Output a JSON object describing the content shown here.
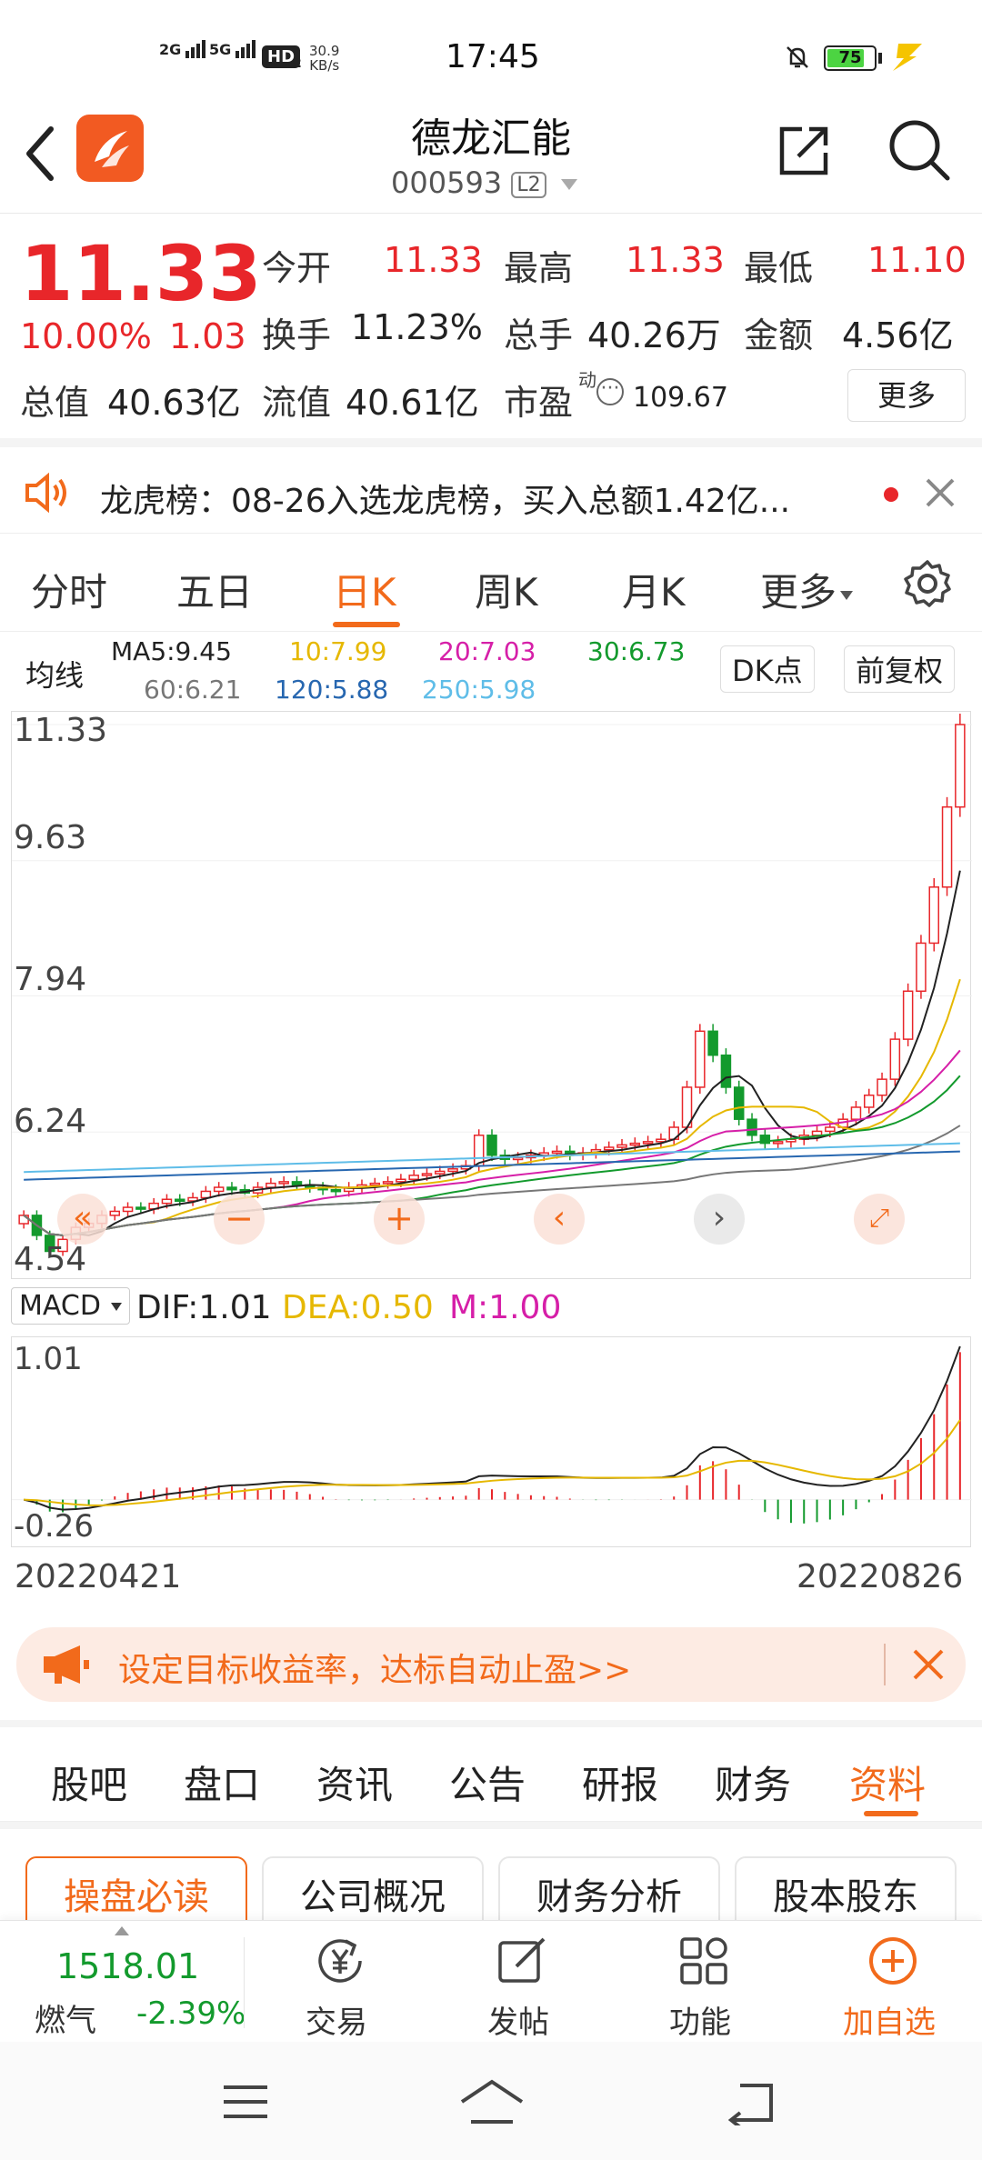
{
  "status": {
    "sig1": "2G",
    "sig2": "5G",
    "hd": "HD",
    "hd_sub": "2",
    "speed_value": "30.9",
    "speed_unit": "KB/s",
    "time": "17:45",
    "battery": "75"
  },
  "header": {
    "title": "德龙汇能",
    "code": "000593",
    "level": "L2"
  },
  "quote": {
    "price": "11.33",
    "change_pct": "10.00%",
    "change_abs": "1.03",
    "open_label": "今开",
    "open_value": "11.33",
    "high_label": "最高",
    "high_value": "11.33",
    "low_label": "最低",
    "low_value": "11.10",
    "turnover_label": "换手",
    "turnover_value": "11.23%",
    "volume_label": "总手",
    "volume_value": "40.26万",
    "amount_label": "金额",
    "amount_value": "4.56亿",
    "mktcap_label": "总值",
    "mktcap_value": "40.63亿",
    "float_label": "流值",
    "float_value": "40.61亿",
    "pe_label": "市盈",
    "pe_sup": "动",
    "pe_value": "109.67",
    "more_button": "更多"
  },
  "notice": {
    "text": "龙虎榜：08-26入选龙虎榜，买入总额1.42亿..."
  },
  "periods": {
    "tabs": [
      "分时",
      "五日",
      "日K",
      "周K",
      "月K",
      "更多"
    ],
    "active_index": 2
  },
  "ma": {
    "label": "均线",
    "ma5": "MA5:9.45",
    "ma10": "10:7.99",
    "ma20": "20:7.03",
    "ma30": "30:6.73",
    "ma60": "60:6.21",
    "ma120": "120:5.88",
    "ma250": "250:5.98",
    "dk_button": "DK点",
    "adjust_button": "前复权",
    "colors": {
      "ma5": "#222222",
      "ma10": "#e6b800",
      "ma20": "#d61fa8",
      "ma30": "#139a2d",
      "ma60": "#777777",
      "ma120": "#2767b0",
      "ma250": "#5fbde8"
    }
  },
  "macd": {
    "selector": "MACD",
    "dif": "DIF:1.01",
    "dea": "DEA:0.50",
    "m": "M:1.00",
    "axis_top": "1.01",
    "axis_bottom": "-0.26"
  },
  "dates": {
    "start": "20220421",
    "end": "20220826"
  },
  "chart_data": {
    "type": "candlestick",
    "y_ticks": [
      "11.33",
      "9.63",
      "7.94",
      "6.24",
      "4.54"
    ],
    "ylim": [
      4.54,
      11.33
    ],
    "x_range": [
      "20220421",
      "20220826"
    ],
    "close_values": [
      5.2,
      4.95,
      4.75,
      4.9,
      5.05,
      5.1,
      5.2,
      5.25,
      5.3,
      5.28,
      5.35,
      5.4,
      5.38,
      5.42,
      5.5,
      5.55,
      5.52,
      5.48,
      5.55,
      5.6,
      5.62,
      5.58,
      5.55,
      5.52,
      5.5,
      5.55,
      5.58,
      5.6,
      5.62,
      5.65,
      5.7,
      5.72,
      5.75,
      5.78,
      5.82,
      6.2,
      5.95,
      5.9,
      5.92,
      5.95,
      5.98,
      6.0,
      5.96,
      5.98,
      6.02,
      6.05,
      6.08,
      6.1,
      6.12,
      6.15,
      6.3,
      6.8,
      7.5,
      7.2,
      6.8,
      6.4,
      6.2,
      6.1,
      6.12,
      6.15,
      6.2,
      6.25,
      6.3,
      6.4,
      6.55,
      6.7,
      6.9,
      7.4,
      8.0,
      8.6,
      9.3,
      10.3,
      11.33
    ]
  },
  "promo": {
    "text": "设定目标收益率，达标自动止盈>>"
  },
  "bottom_tabs": {
    "tabs": [
      "股吧",
      "盘口",
      "资讯",
      "公告",
      "研报",
      "财务",
      "资料"
    ],
    "active_index": 6
  },
  "sub_tabs": [
    "操盘必读",
    "公司概况",
    "财务分析",
    "股本股东"
  ],
  "toolbar": {
    "index_value": "1518.01",
    "index_name": "燃气",
    "index_change": "-2.39%",
    "trade": "交易",
    "post": "发帖",
    "func": "功能",
    "add": "加自选"
  }
}
